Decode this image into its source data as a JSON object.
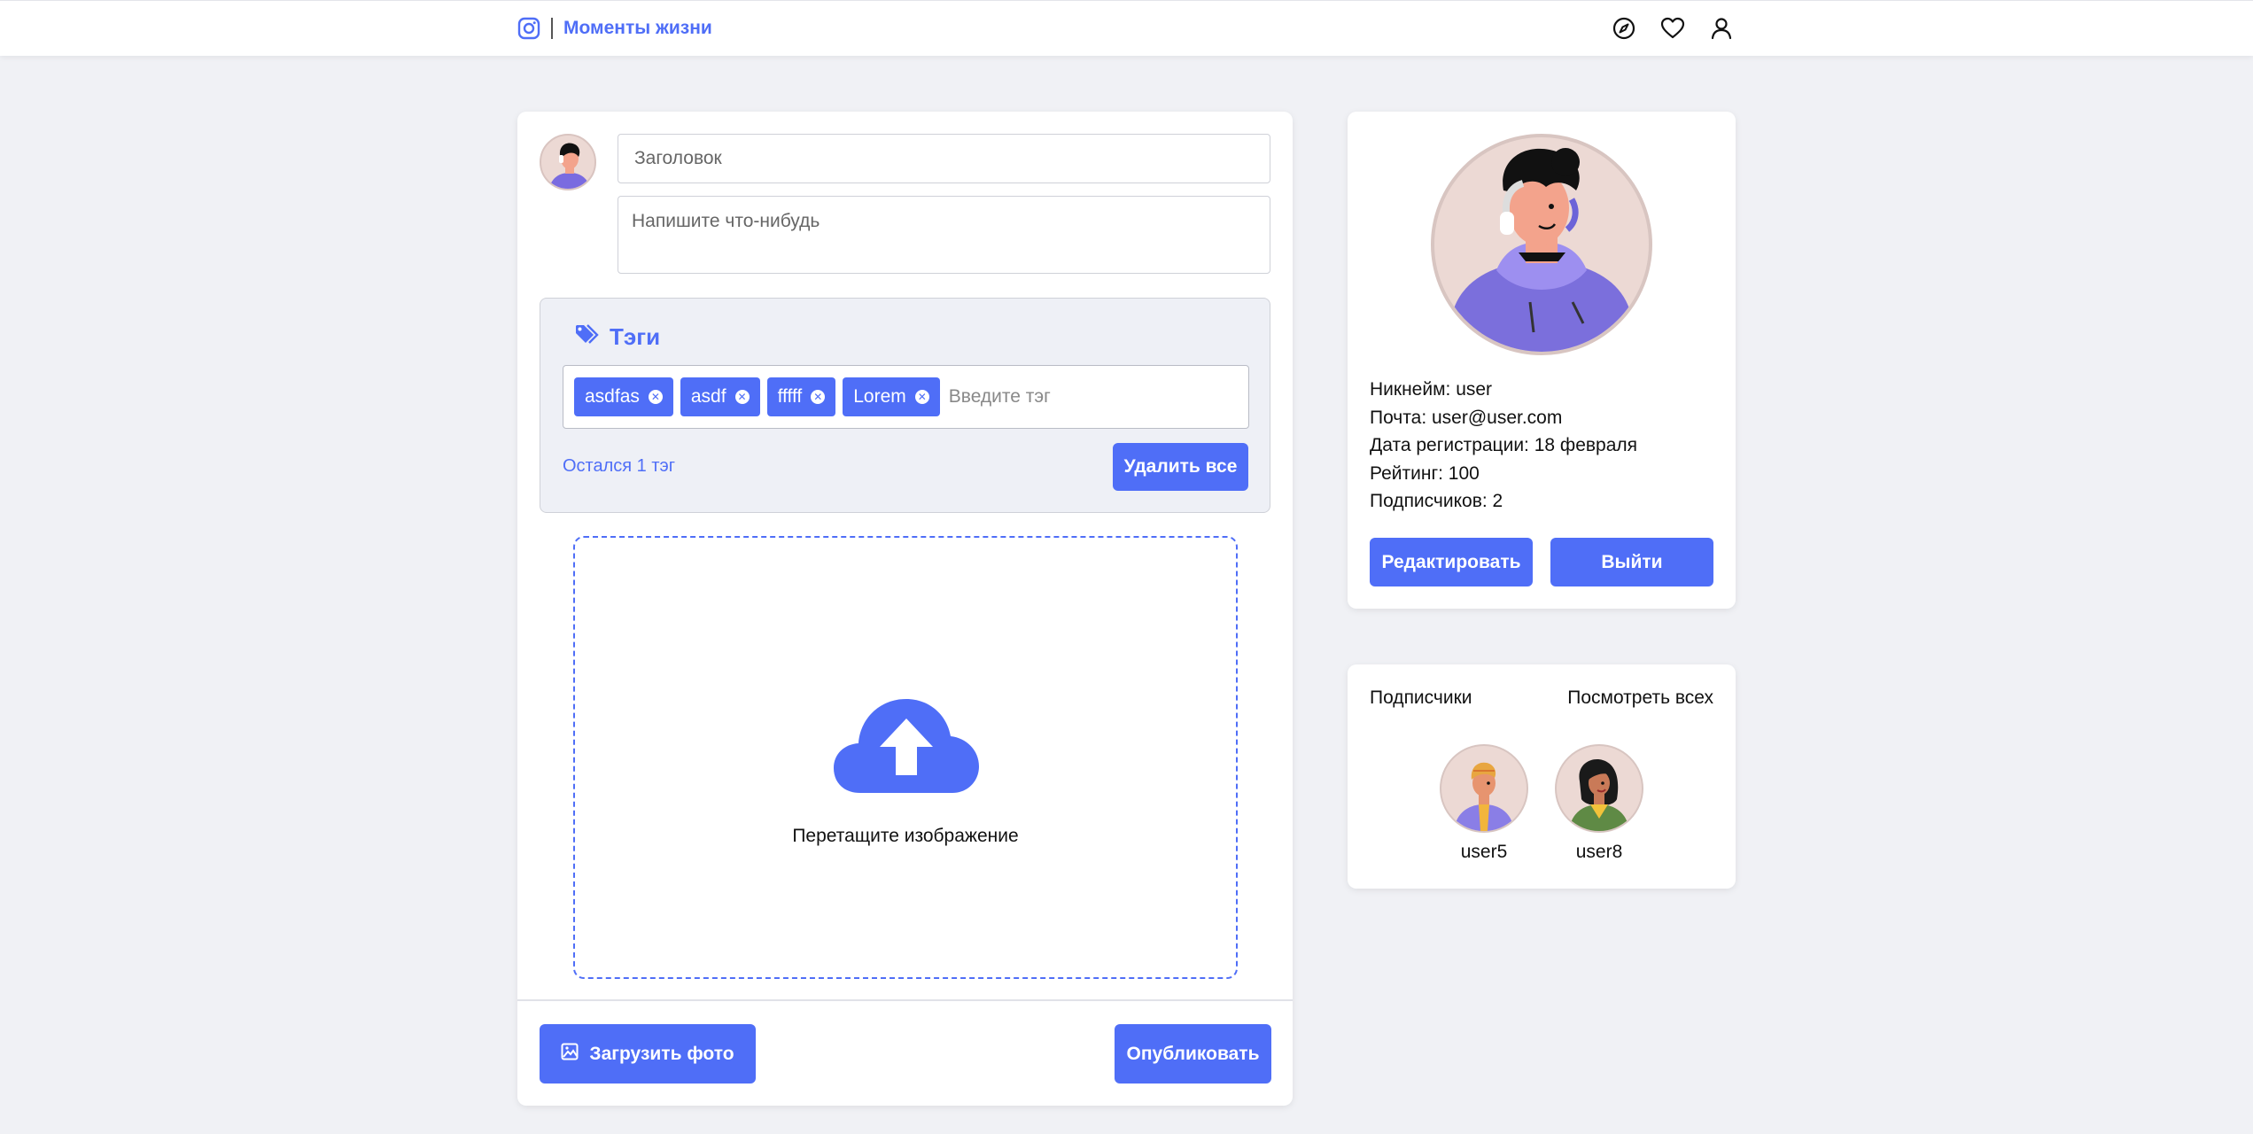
{
  "header": {
    "brand_name": "Моменты жизни",
    "icons": [
      "instagram-icon",
      "compass-icon",
      "heart-icon",
      "user-icon"
    ]
  },
  "composer": {
    "title_placeholder": "Заголовок",
    "body_placeholder": "Напишите что-нибудь",
    "tags": {
      "label": "Тэги",
      "chips": [
        "asdfas",
        "asdf",
        "fffff",
        "Lorem"
      ],
      "input_placeholder": "Введите тэг",
      "remaining": "Остался 1 тэг",
      "delete_all": "Удалить все"
    },
    "drop_text": "Перетащите изображение",
    "upload_label": "Загрузить фото",
    "publish_label": "Опубликовать"
  },
  "profile": {
    "nickname": "Никнейм: user",
    "email": "Почта: user@user.com",
    "registered": "Дата регистрации: 18 февраля",
    "rating": "Рейтинг: 100",
    "subscribers": "Подписчиков: 2",
    "edit_label": "Редактировать",
    "logout_label": "Выйти"
  },
  "subscribers": {
    "title": "Подписчики",
    "view_all": "Посмотреть всех",
    "users": [
      "user5",
      "user8"
    ]
  },
  "colors": {
    "accent": "#4f6ef7",
    "background": "#f0f1f5"
  }
}
